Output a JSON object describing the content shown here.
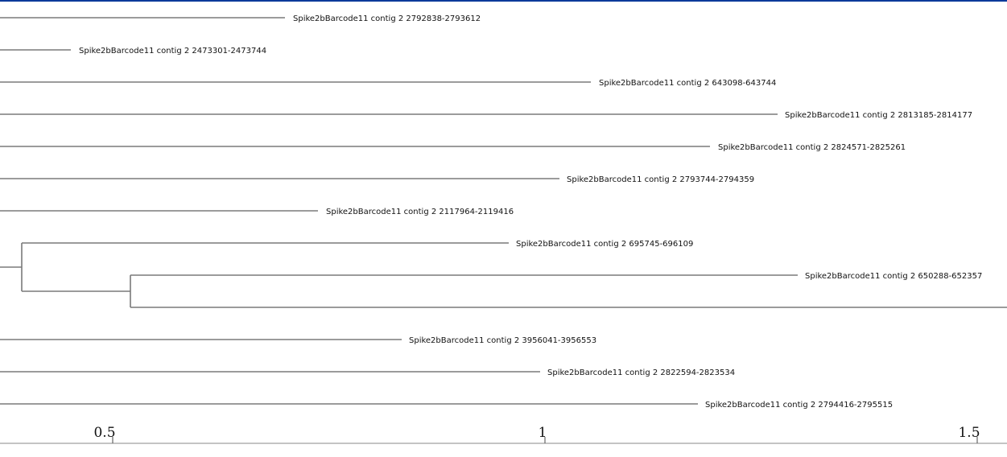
{
  "header": {
    "accent_color": "#0a3a9a"
  },
  "tree": {
    "branch_color": "#7a7a7a",
    "leaves": [
      "Spike2bBarcode11 contig 2 2792838-2793612",
      "Spike2bBarcode11 contig 2 2473301-2473744",
      "Spike2bBarcode11 contig 2 643098-643744",
      "Spike2bBarcode11 contig 2 2813185-2814177",
      "Spike2bBarcode11 contig 2 2824571-2825261",
      "Spike2bBarcode11 contig 2 2793744-2794359",
      "Spike2bBarcode11 contig 2 2117964-2119416",
      "Spike2bBarcode11 contig 2 695745-696109",
      "Spike2bBarcode11 contig 2 650288-652357",
      "",
      "Spike2bBarcode11 contig 2 3956041-3956553",
      "Spike2bBarcode11 contig 2 2822594-2823534",
      "Spike2bBarcode11 contig 2 2794416-2795515"
    ]
  },
  "axis": {
    "ticks": [
      {
        "value": 0.5,
        "label": "0.5"
      },
      {
        "value": 1,
        "label": "1"
      },
      {
        "value": 1.5,
        "label": "1.5"
      }
    ]
  }
}
